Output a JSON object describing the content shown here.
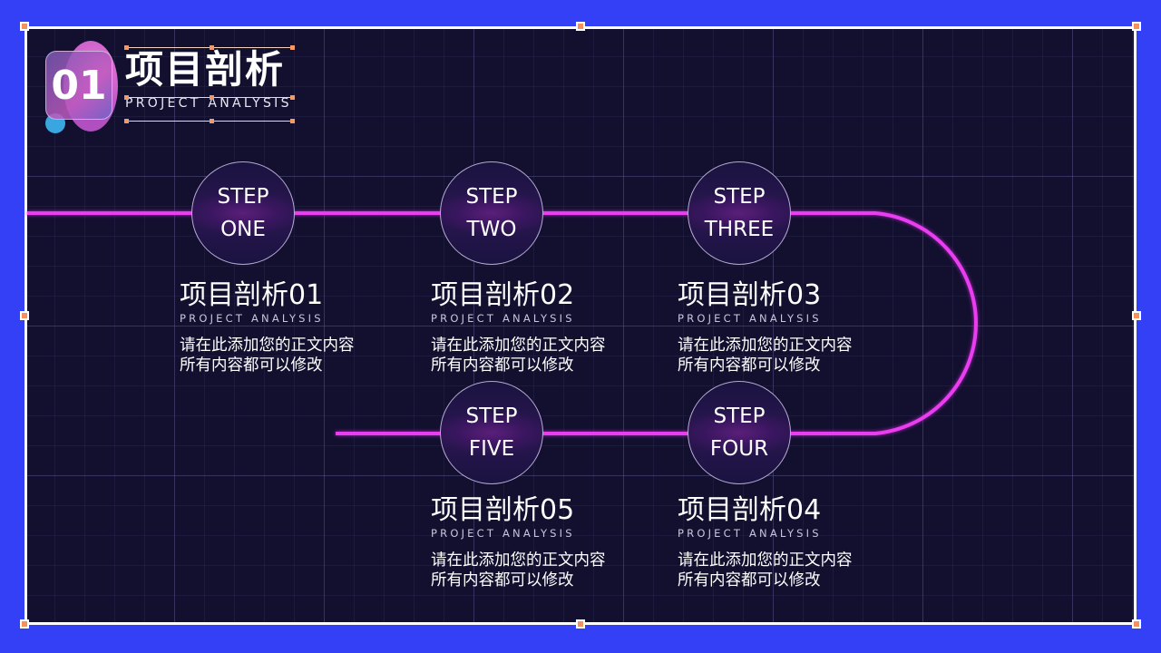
{
  "header": {
    "badge_number": "01",
    "title": "项目剖析",
    "subtitle": "PROJECT ANALYSIS"
  },
  "colors": {
    "background_outer": "#3340f5",
    "slide_bg": "#12102e",
    "path_line": "#e83ef0",
    "handle": "#f4915c"
  },
  "steps": [
    {
      "line1": "STEP",
      "line2": "ONE"
    },
    {
      "line1": "STEP",
      "line2": "TWO"
    },
    {
      "line1": "STEP",
      "line2": "THREE"
    },
    {
      "line1": "STEP",
      "line2": "FOUR"
    },
    {
      "line1": "STEP",
      "line2": "FIVE"
    }
  ],
  "blocks": [
    {
      "title": "项目剖析01",
      "subtitle": "PROJECT ANALYSIS",
      "desc1": "请在此添加您的正文内容",
      "desc2": "所有内容都可以修改"
    },
    {
      "title": "项目剖析02",
      "subtitle": "PROJECT ANALYSIS",
      "desc1": "请在此添加您的正文内容",
      "desc2": "所有内容都可以修改"
    },
    {
      "title": "项目剖析03",
      "subtitle": "PROJECT ANALYSIS",
      "desc1": "请在此添加您的正文内容",
      "desc2": "所有内容都可以修改"
    },
    {
      "title": "项目剖析04",
      "subtitle": "PROJECT ANALYSIS",
      "desc1": "请在此添加您的正文内容",
      "desc2": "所有内容都可以修改"
    },
    {
      "title": "项目剖析05",
      "subtitle": "PROJECT ANALYSIS",
      "desc1": "请在此添加您的正文内容",
      "desc2": "所有内容都可以修改"
    }
  ]
}
